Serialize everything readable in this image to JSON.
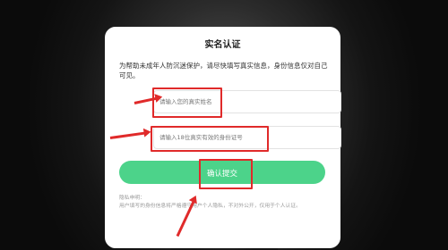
{
  "dialog": {
    "title": "实名认证",
    "notice": "为帮助未成年人防沉迷保护，请尽快填写真实信息，身份信息仅对自己可见。",
    "name_row": {
      "label": "",
      "placeholder": "请输入您的真实姓名"
    },
    "id_row": {
      "label": "",
      "placeholder": "请输入18位真实有效的身份证号"
    },
    "submit_label": "确认提交",
    "privacy_title": "隐私申明：",
    "privacy_text": "用户填写的身份信息将严格遵守用户个人隐私，不对外公开，仅用于个人认证。"
  },
  "annotations": {
    "color": "#e02a2a"
  },
  "colors": {
    "submit_green": "#4cd38a"
  }
}
